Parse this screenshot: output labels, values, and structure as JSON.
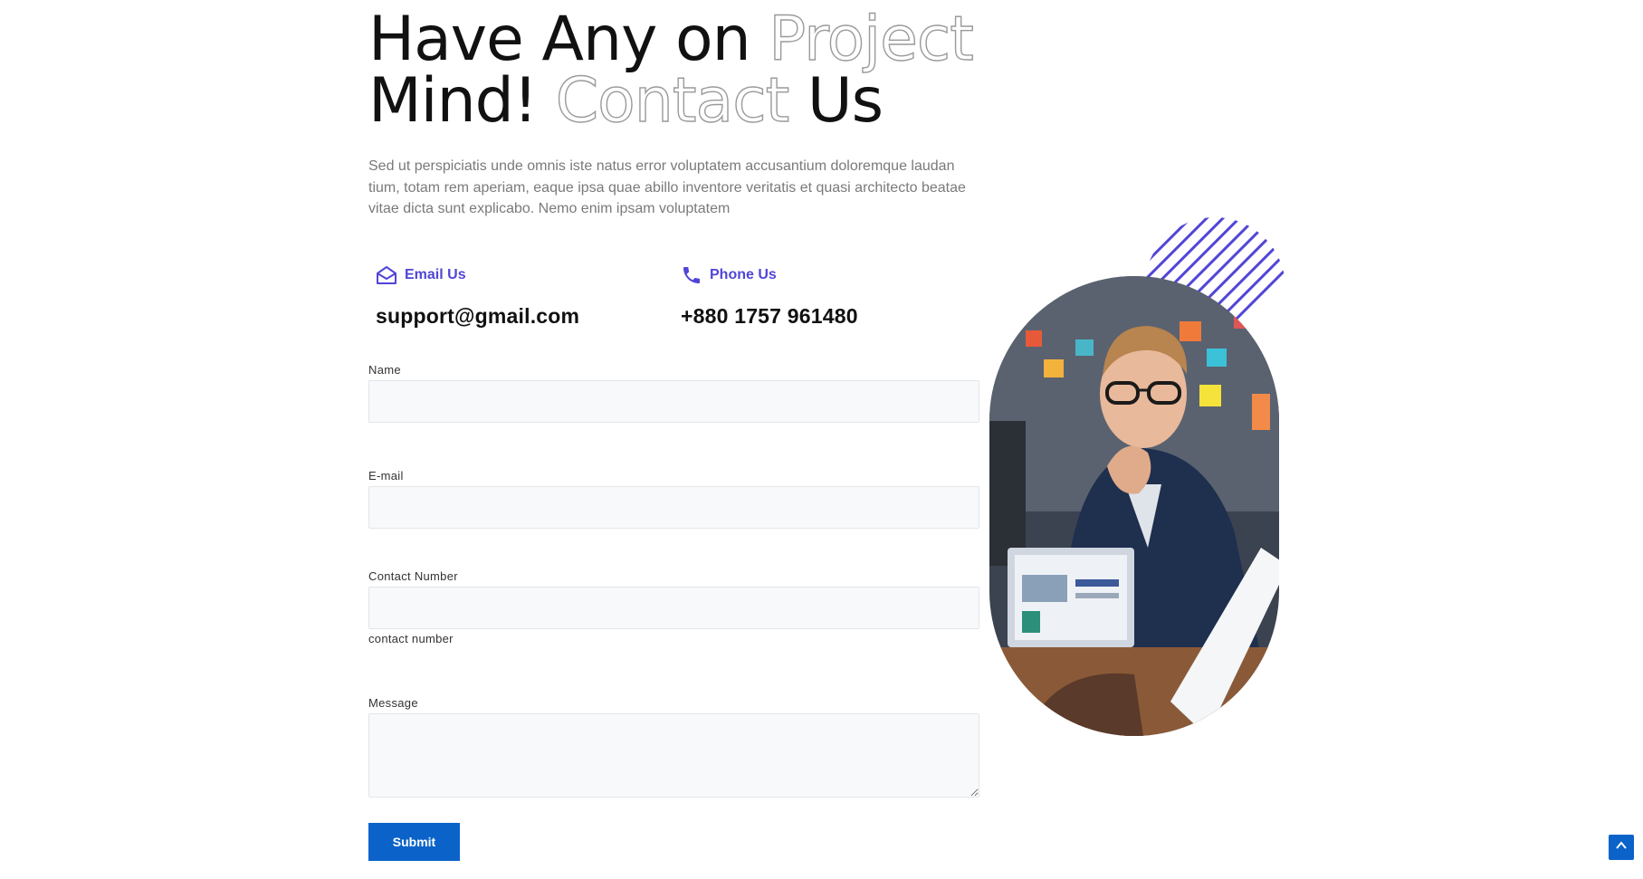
{
  "headline": {
    "line1_plain": "Have Any on ",
    "line1_outline": "Project",
    "line2_plain_start": "Mind! ",
    "line2_outline": "Contact",
    "line2_plain_end": " Us"
  },
  "intro": "Sed ut perspiciatis unde omnis iste natus error voluptatem accusantium doloremque laudan tium, totam rem aperiam, eaque ipsa quae abillo inventore veritatis et quasi architecto beatae vitae dicta sunt explicabo. Nemo enim ipsam voluptatem",
  "contact": {
    "email": {
      "icon": "envelope-open-icon",
      "label": "Email Us",
      "value": "support@gmail.com"
    },
    "phone": {
      "icon": "phone-icon",
      "label": "Phone Us",
      "value": "+880 1757 961480"
    }
  },
  "form": {
    "name_label": "Name",
    "name_value": "",
    "email_label": "E-mail",
    "email_value": "",
    "contact_number_label": "Contact Number",
    "contact_number_value": "",
    "contact_number_helper": "contact number",
    "message_label": "Message",
    "message_value": "",
    "submit_label": "Submit"
  },
  "colors": {
    "accent": "#5145d6",
    "button": "#0b63c9",
    "field_bg": "#f8f9fb"
  },
  "icons": {
    "scroll_top": "chevron-up-icon"
  }
}
